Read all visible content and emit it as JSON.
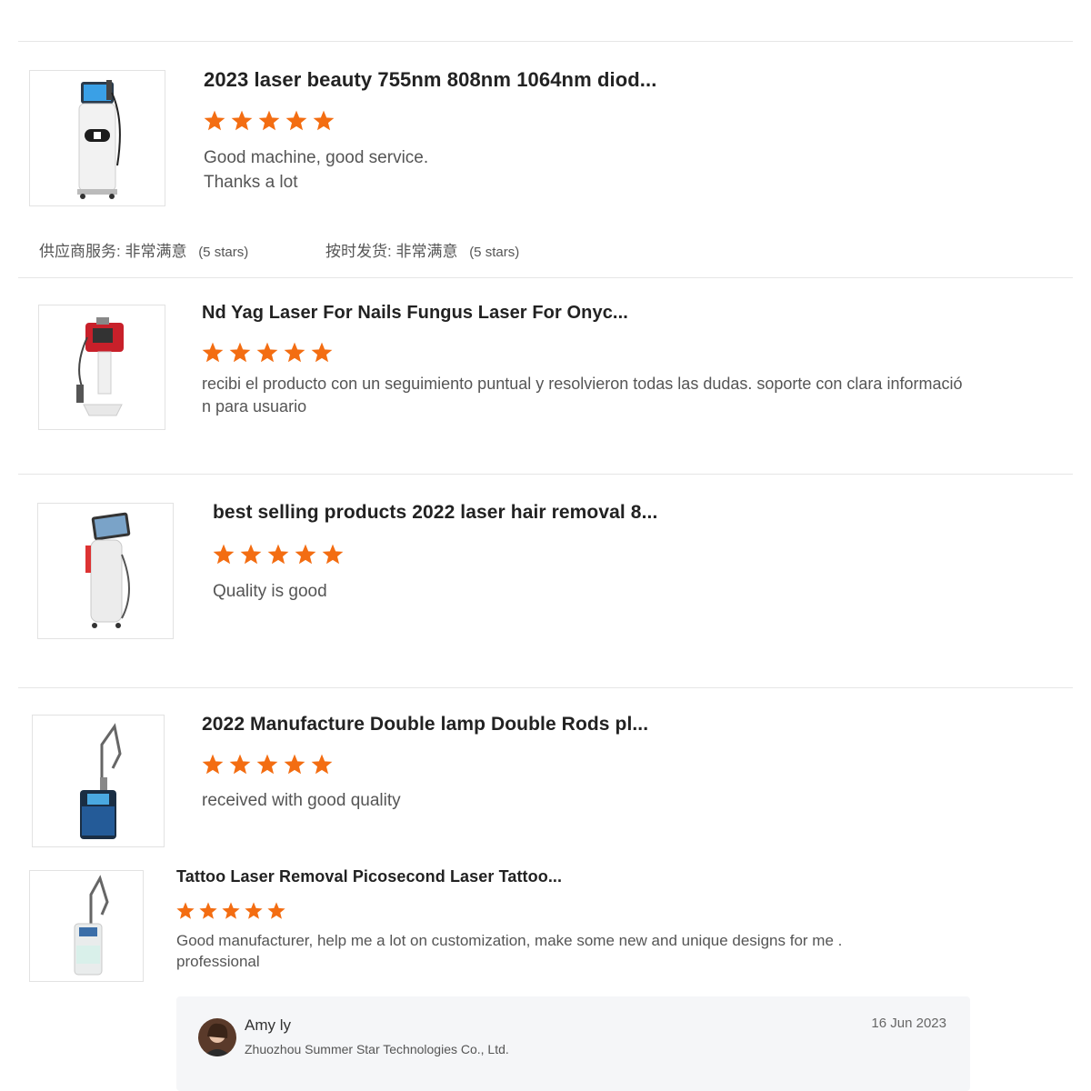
{
  "colors": {
    "star": "#f36d12",
    "divider": "#e6e6e6",
    "card_bg": "#f5f6f8"
  },
  "reviews": [
    {
      "product_title": "2023 laser beauty 755nm 808nm 1064nm diod...",
      "rating_stars": 5,
      "review_lines": [
        "Good machine, good service.",
        "Thanks a lot"
      ],
      "thumbnail_icon": "diode-laser-machine-icon",
      "ratings": [
        {
          "label": "供应商服务: 非常满意",
          "stars_text": "(5 stars)"
        },
        {
          "label": "按时发货: 非常满意",
          "stars_text": "(5 stars)"
        }
      ]
    },
    {
      "product_title": "Nd Yag Laser For Nails Fungus Laser For Onyc...",
      "rating_stars": 5,
      "review_lines": [
        "recibi el producto con un seguimiento puntual y resolvieron todas las dudas. soporte con clara  informació",
        "n para usuario"
      ],
      "thumbnail_icon": "nd-yag-laser-machine-icon"
    },
    {
      "product_title": "best selling products 2022 laser hair removal 8...",
      "rating_stars": 5,
      "review_lines": [
        "Quality is good"
      ],
      "thumbnail_icon": "hair-removal-laser-machine-icon"
    },
    {
      "product_title": "2022 Manufacture Double lamp Double Rods pl...",
      "rating_stars": 5,
      "review_lines": [
        "received with good quality"
      ],
      "thumbnail_icon": "pico-laser-machine-icon"
    },
    {
      "product_title": "Tattoo Laser Removal Picosecond Laser Tattoo...",
      "rating_stars": 5,
      "review_lines": [
        "Good manufacturer, help me a lot on customization, make some new and unique designs for me .",
        "professional"
      ],
      "thumbnail_icon": "tattoo-removal-laser-machine-icon"
    }
  ],
  "buyer": {
    "name": "Amy ly",
    "company": "Zhuozhou Summer Star Technologies Co., Ltd.",
    "date": "16 Jun 2023",
    "avatar_icon": "avatar-icon"
  }
}
